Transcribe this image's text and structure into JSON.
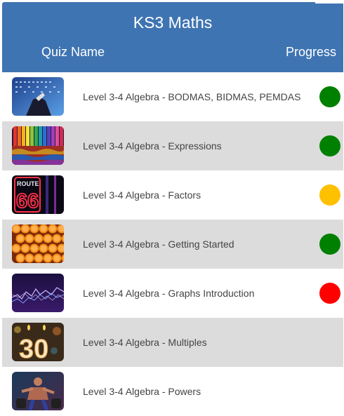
{
  "header": {
    "title": "KS3 Maths",
    "col_quiz": "Quiz Name",
    "col_progress": "Progress"
  },
  "quizzes": [
    {
      "label": "Level 3-4 Algebra - BODMAS, BIDMAS, PEMDAS",
      "status_color": "#008000",
      "thumb": "calculator-photo"
    },
    {
      "label": "Level 3-4 Algebra - Expressions",
      "status_color": "#008000",
      "thumb": "colored-pencils-photo"
    },
    {
      "label": "Level 3-4 Algebra - Factors",
      "status_color": "#ffc000",
      "thumb": "route-66-neon-photo",
      "thumb_text": "ROUTE 66"
    },
    {
      "label": "Level 3-4 Algebra - Getting Started",
      "status_color": "#008000",
      "thumb": "orange-slices-photo"
    },
    {
      "label": "Level 3-4 Algebra - Graphs Introduction",
      "status_color": "#ff0000",
      "thumb": "graph-lines-photo"
    },
    {
      "label": "Level 3-4 Algebra - Multiples",
      "status_color": "#000000",
      "thumb": "birthday-30-candles-photo",
      "thumb_text": "30"
    },
    {
      "label": "Level 3-4 Algebra - Powers",
      "status_color": "#000000",
      "thumb": "weightlifter-photo"
    }
  ],
  "colors": {
    "header_bg": "#3f74b2",
    "alt_row_bg": "#dcdcdc"
  }
}
